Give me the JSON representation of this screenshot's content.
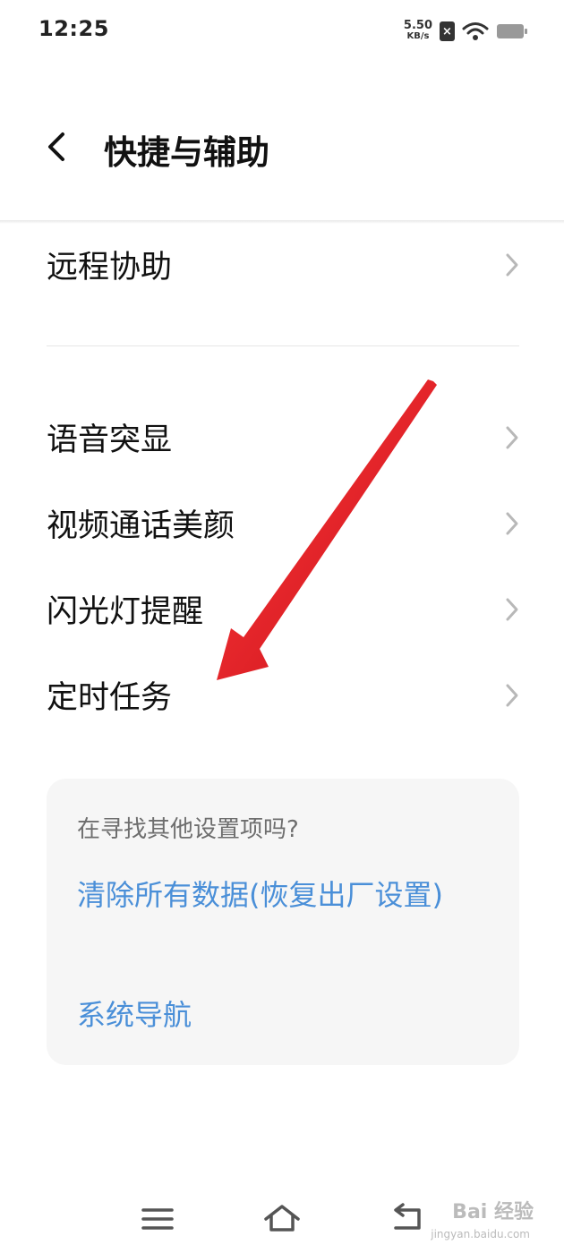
{
  "status_bar": {
    "time": "12:25",
    "net_speed_value": "5.50",
    "net_speed_unit": "KB/s",
    "sim_icon": "sim-x-icon",
    "wifi_icon": "wifi-icon",
    "battery_icon": "battery-icon"
  },
  "header": {
    "back_icon": "back-arrow-icon",
    "title": "快捷与辅助"
  },
  "menu": {
    "items": [
      {
        "label": "远程协助"
      },
      {
        "label": "语音突显"
      },
      {
        "label": "视频通话美颜"
      },
      {
        "label": "闪光灯提醒"
      },
      {
        "label": "定时任务"
      }
    ]
  },
  "suggestions": {
    "hint": "在寻找其他设置项吗?",
    "links": [
      {
        "label": "清除所有数据(恢复出厂设置)"
      },
      {
        "label": "系统导航"
      }
    ]
  },
  "nav_bar": {
    "icons": [
      "menu-icon",
      "home-icon",
      "back-icon"
    ]
  },
  "watermark": {
    "text": "Bai 经验",
    "sub": "jingyan.baidu.com"
  },
  "colors": {
    "link": "#4a8fd8",
    "card_bg": "#f6f6f6",
    "annotation_arrow": "#e8141c"
  }
}
